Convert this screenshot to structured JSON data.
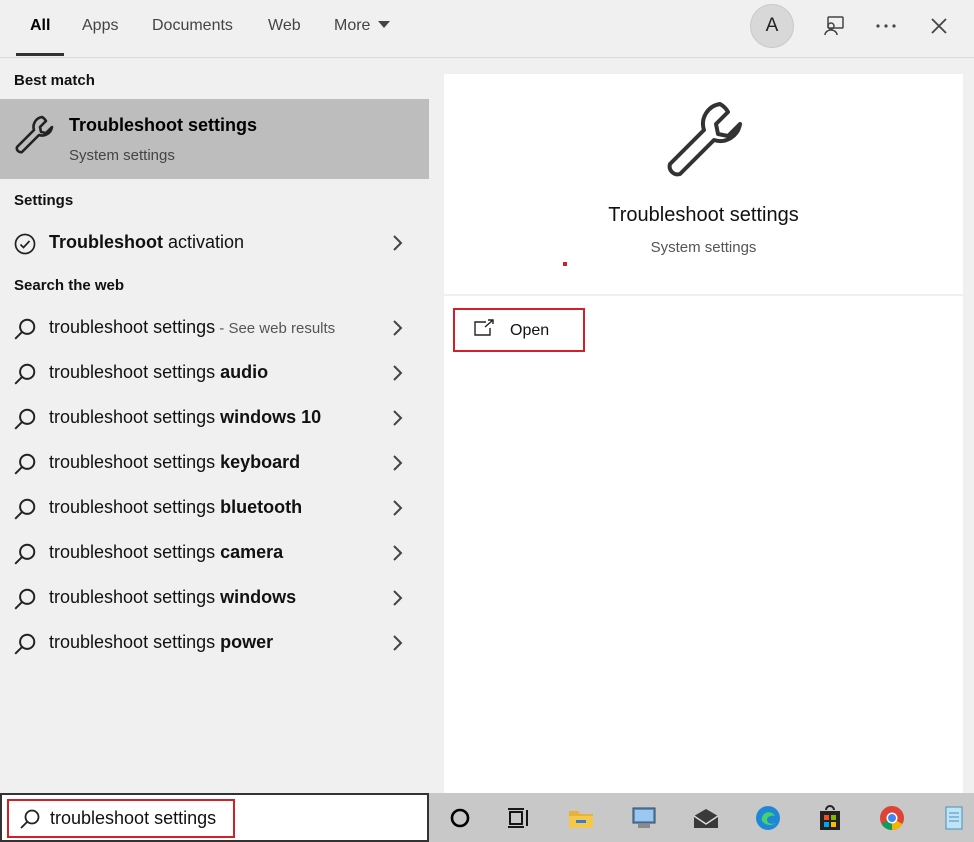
{
  "tabs": {
    "all": "All",
    "apps": "Apps",
    "documents": "Documents",
    "web": "Web",
    "more": "More"
  },
  "account": {
    "initial": "A"
  },
  "left": {
    "best_match_heading": "Best match",
    "best_match": {
      "title": "Troubleshoot settings",
      "subtitle": "System settings"
    },
    "settings_heading": "Settings",
    "settings_item": {
      "normal": "Troubleshoot",
      "bold": " activation"
    },
    "web_heading": "Search the web",
    "web_items": [
      {
        "prefix": "troubleshoot settings",
        "bold": "",
        "hint": " - See web results"
      },
      {
        "prefix": "troubleshoot settings ",
        "bold": "audio",
        "hint": ""
      },
      {
        "prefix": "troubleshoot settings ",
        "bold": "windows 10",
        "hint": ""
      },
      {
        "prefix": "troubleshoot settings ",
        "bold": "keyboard",
        "hint": ""
      },
      {
        "prefix": "troubleshoot settings ",
        "bold": "bluetooth",
        "hint": ""
      },
      {
        "prefix": "troubleshoot settings ",
        "bold": "camera",
        "hint": ""
      },
      {
        "prefix": "troubleshoot settings ",
        "bold": "windows",
        "hint": ""
      },
      {
        "prefix": "troubleshoot settings ",
        "bold": "power",
        "hint": ""
      }
    ]
  },
  "preview": {
    "title": "Troubleshoot settings",
    "subtitle": "System settings",
    "open_label": "Open"
  },
  "search": {
    "value": "troubleshoot settings"
  },
  "colors": {
    "highlight_red": "#d32027",
    "selected_bg": "#bdbdbd"
  },
  "taskbar_icons": [
    "cortana-icon",
    "task-view-icon",
    "file-explorer-icon",
    "this-pc-icon",
    "mail-icon",
    "edge-icon",
    "store-icon",
    "chrome-icon",
    "notepad-icon"
  ]
}
